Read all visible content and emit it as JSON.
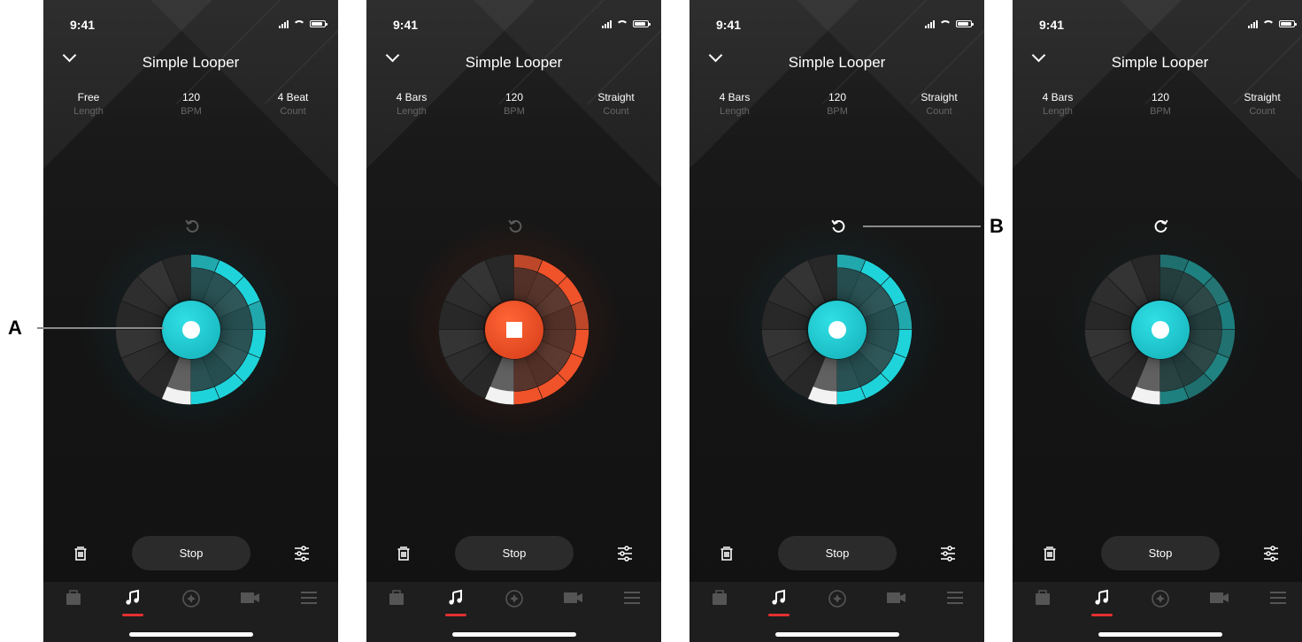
{
  "screens": [
    {
      "time": "9:41",
      "title": "Simple Looper",
      "stats": [
        {
          "value": "Free",
          "label": "Length"
        },
        {
          "value": "120",
          "label": "BPM"
        },
        {
          "value": "4 Beat",
          "label": "Count"
        }
      ],
      "stop_label": "Stop",
      "accent": "#1fd3da",
      "state": "idle"
    },
    {
      "time": "9:41",
      "title": "Simple Looper",
      "stats": [
        {
          "value": "4 Bars",
          "label": "Length"
        },
        {
          "value": "120",
          "label": "BPM"
        },
        {
          "value": "Straight",
          "label": "Count"
        }
      ],
      "stop_label": "Stop",
      "accent": "#f0522a",
      "state": "recording"
    },
    {
      "time": "9:41",
      "title": "Simple Looper",
      "stats": [
        {
          "value": "4 Bars",
          "label": "Length"
        },
        {
          "value": "120",
          "label": "BPM"
        },
        {
          "value": "Straight",
          "label": "Count"
        }
      ],
      "stop_label": "Stop",
      "accent": "#1fd3da",
      "state": "playing-undo"
    },
    {
      "time": "9:41",
      "title": "Simple Looper",
      "stats": [
        {
          "value": "4 Bars",
          "label": "Length"
        },
        {
          "value": "120",
          "label": "BPM"
        },
        {
          "value": "Straight",
          "label": "Count"
        }
      ],
      "stop_label": "Stop",
      "accent": "#17a9a8",
      "state": "playing-redo"
    }
  ],
  "tabs": [
    "amp-icon",
    "music-note-icon",
    "compass-icon",
    "video-camera-icon",
    "menu-icon"
  ],
  "callouts": {
    "a": "A",
    "b": "B"
  }
}
